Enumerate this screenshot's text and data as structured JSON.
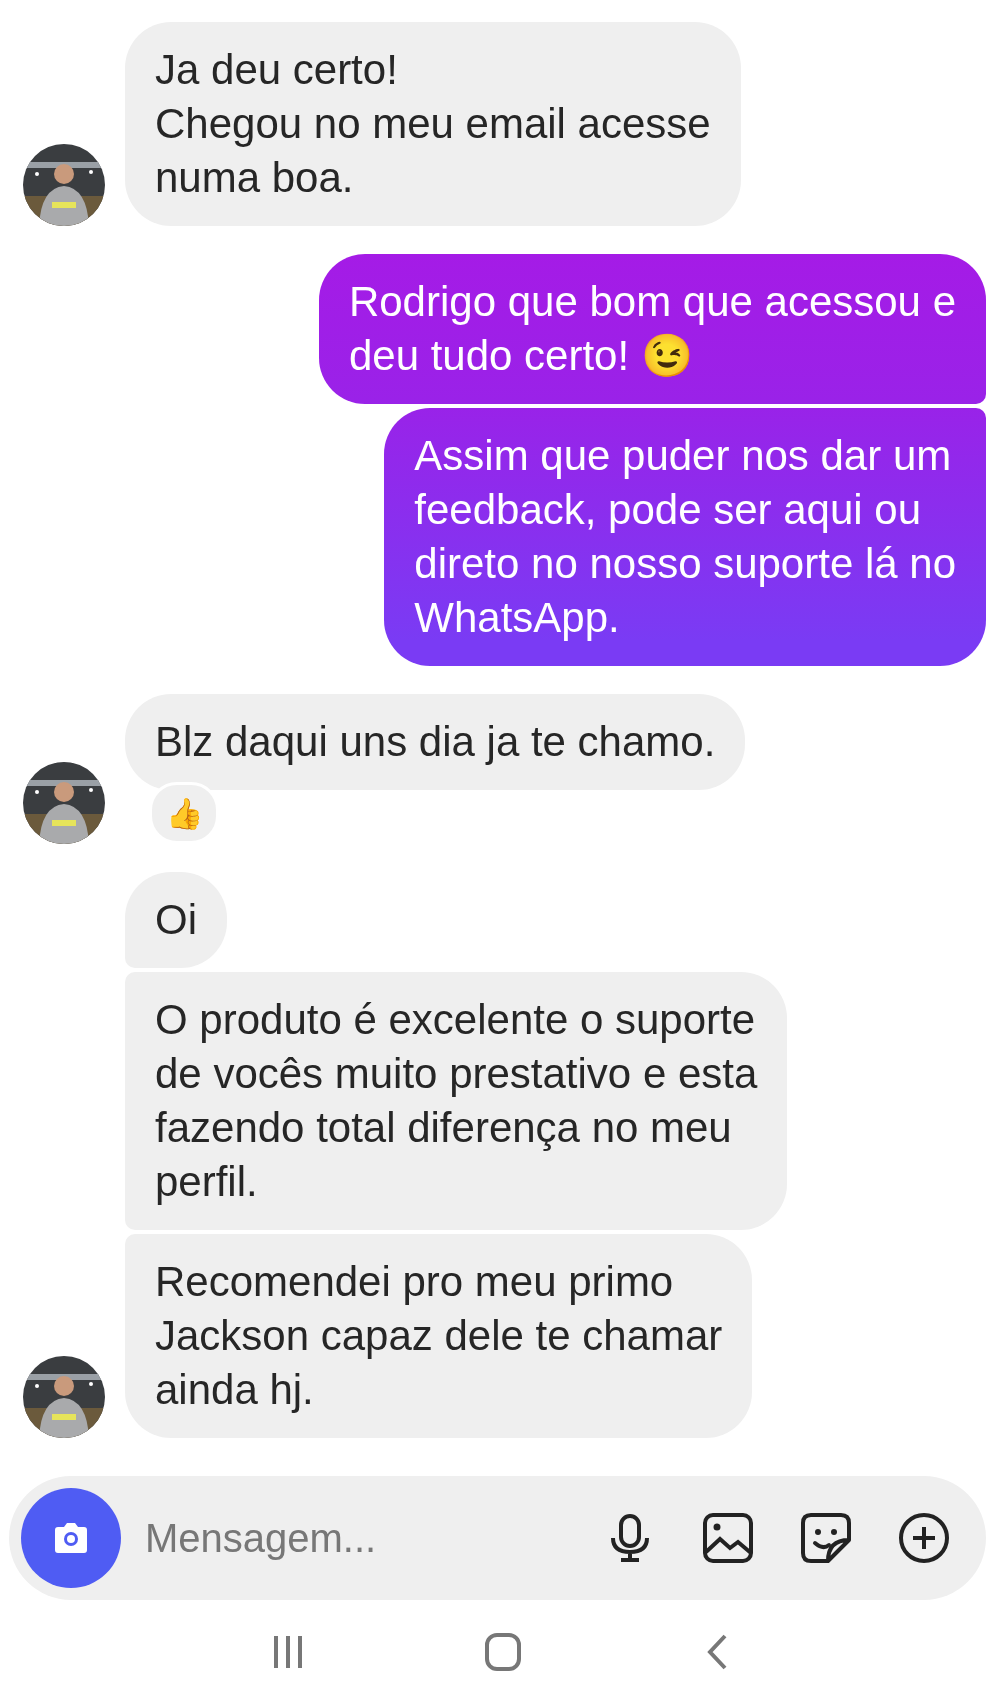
{
  "messages": [
    {
      "kind": "incoming",
      "text": "Ja deu certo!\nChegou no meu email acesse\nnuma boa.",
      "avatar": true
    },
    {
      "kind": "outgoing",
      "text": "Rodrigo que bom que acessou e\ndeu tudo certo! 😉"
    },
    {
      "kind": "outgoing",
      "text": "Assim que puder nos dar um\nfeedback, pode ser aqui ou\ndireto no nosso suporte lá no\nWhatsApp."
    },
    {
      "kind": "incoming",
      "text": "Blz daqui uns dia ja te chamo.",
      "avatar": true,
      "reaction": "👍"
    },
    {
      "kind": "incoming",
      "text": "Oi",
      "avatar": false
    },
    {
      "kind": "incoming",
      "text": "O produto é excelente o suporte\nde vocês muito prestativo e esta\nfazendo total diferença no meu\nperfil.",
      "avatar": false
    },
    {
      "kind": "incoming",
      "text": "Recomendei pro meu primo\nJackson capaz dele te chamar\nainda hj.",
      "avatar": true
    }
  ],
  "composer": {
    "placeholder": "Mensagem..."
  }
}
